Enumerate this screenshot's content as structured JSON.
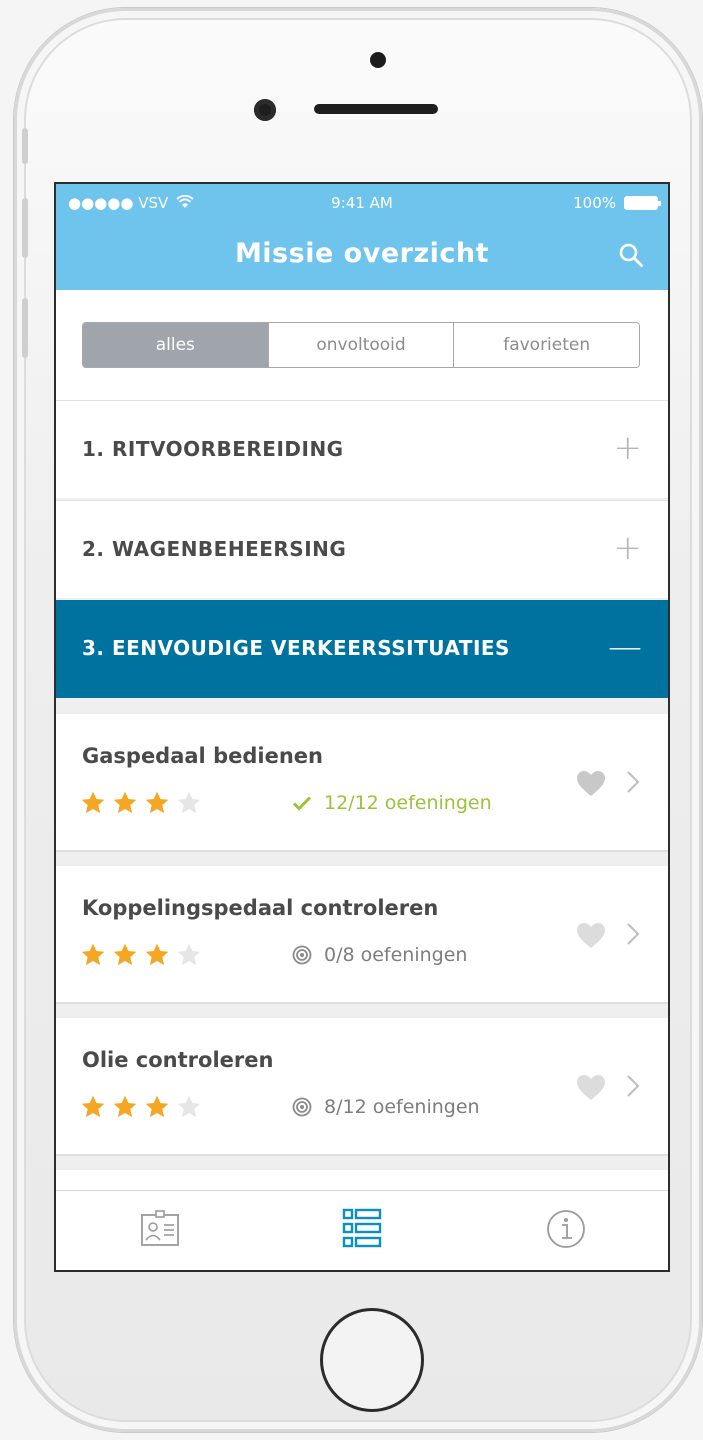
{
  "status_bar": {
    "carrier": "●●●●● VSV",
    "time": "9:41 AM",
    "battery": "100%"
  },
  "nav": {
    "title": "Missie overzicht"
  },
  "segments": [
    "alles",
    "onvoltooid",
    "favorieten"
  ],
  "selected_segment": "alles",
  "sections": [
    {
      "label": "1. RITVOORBEREIDING",
      "toggle": "+"
    },
    {
      "label": "2. WAGENBEHEERSING",
      "toggle": "+"
    },
    {
      "label": "3. EENVOUDIGE VERKEERSSITUATIES",
      "toggle": "—"
    }
  ],
  "items": [
    {
      "name": "Gaspedaal bedienen",
      "stars": 3,
      "progress": "12/12 oefeningen",
      "completed": true
    },
    {
      "name": "Koppelingspedaal controleren",
      "stars": 3,
      "progress": "0/8 oefeningen",
      "completed": false
    },
    {
      "name": "Olie controleren",
      "stars": 3,
      "progress": "8/12 oefeningen",
      "completed": false
    }
  ],
  "colors": {
    "header": "#6ec4ec",
    "active_section": "#0072a0",
    "star": "#f5a623",
    "check": "#9cc23a"
  },
  "icons": [
    "search-icon",
    "wifi-icon",
    "battery-icon",
    "star-icon",
    "check-icon",
    "target-icon",
    "heart-icon",
    "chevron-right-icon",
    "profile-card-icon",
    "list-icon",
    "info-icon"
  ]
}
